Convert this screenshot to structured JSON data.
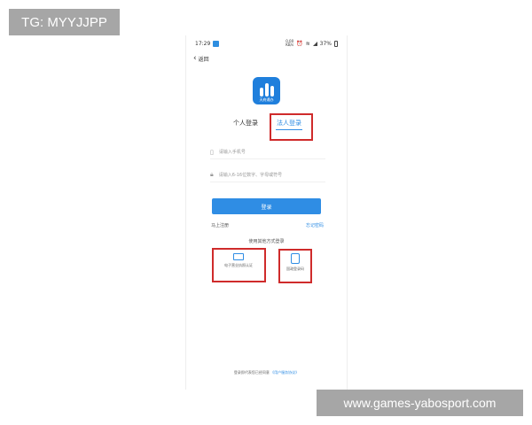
{
  "watermarks": {
    "top": "TG: MYYJJPP",
    "bottom": "www.games-yabosport.com"
  },
  "status_bar": {
    "time": "17:29",
    "net_rate": "0.00\nKB/s",
    "battery": "37%"
  },
  "nav": {
    "back_label": "返回"
  },
  "app": {
    "logo_text": "天府通办"
  },
  "tabs": {
    "personal": "个人登录",
    "legal": "法人登录",
    "active": "legal"
  },
  "form": {
    "phone_placeholder": "请输入手机号",
    "password_placeholder": "请输入6-16位数字、字母或符号",
    "login_label": "登录",
    "register_label": "马上注册",
    "forgot_label": "忘记密码"
  },
  "other_login": {
    "title": "使用其他方式登录",
    "options": [
      {
        "label": "电子营业执照认证",
        "icon": "business-license-icon"
      },
      {
        "label": "国政登录码",
        "icon": "qr-phone-icon"
      }
    ]
  },
  "agreement": {
    "prefix": "登录即代表您已经同意",
    "link": "《用户服务协议》"
  },
  "colors": {
    "accent": "#2f8de4",
    "highlight_box": "#cf2b2b"
  }
}
